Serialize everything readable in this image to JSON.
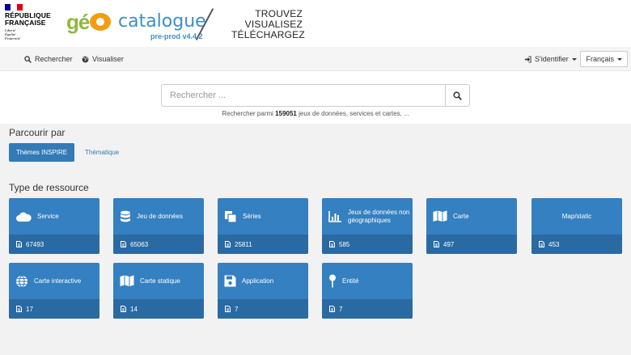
{
  "header": {
    "rf_name_line1": "RÉPUBLIQUE",
    "rf_name_line2": "FRANÇAISE",
    "rf_motto_1": "Liberté",
    "rf_motto_2": "Égalité",
    "rf_motto_3": "Fraternité",
    "logo_catalogue": "catalogue",
    "logo_version": "pre-prod v4.4.2",
    "tagline": [
      "TROUVEZ",
      "VISUALISEZ",
      "TÉLÉCHARGEZ"
    ],
    "flag_colors": [
      "#000091",
      "#ffffff",
      "#e1000f"
    ]
  },
  "nav": {
    "search": "Rechercher",
    "visualize": "Visualiser",
    "signin": "S'identifier",
    "language": "Français"
  },
  "search": {
    "placeholder": "Rechercher ...",
    "hint_prefix": "Rechercher parmi",
    "hint_count": "159051",
    "hint_suffix": "jeux de données, services et cartes, ..."
  },
  "browse": {
    "title": "Parcourir par",
    "active_tab": "Thèmes INSPIRE",
    "other_tab": "Thématique"
  },
  "resources": {
    "title": "Type de ressource",
    "tiles": [
      {
        "icon": "cloud-icon",
        "label": "Service",
        "count": "67493"
      },
      {
        "icon": "database-icon",
        "label": "Jeu de données",
        "count": "65063"
      },
      {
        "icon": "copy-icon",
        "label": "Séries",
        "count": "25811"
      },
      {
        "icon": "bar-chart-icon",
        "label": "Jeux de données non géographiques",
        "count": "585"
      },
      {
        "icon": "map-icon",
        "label": "Carte",
        "count": "497"
      },
      {
        "icon": "",
        "label": "Map/static",
        "count": "453"
      },
      {
        "icon": "globe-icon",
        "label": "Carte interactive",
        "count": "17"
      },
      {
        "icon": "map-icon",
        "label": "Carte statique",
        "count": "14"
      },
      {
        "icon": "save-icon",
        "label": "Application",
        "count": "7"
      },
      {
        "icon": "pin-icon",
        "label": "Entité",
        "count": "7"
      }
    ]
  },
  "colors": {
    "tile": "#3480c0",
    "tile_footer": "#2a6aa3",
    "accent": "#337ab7"
  }
}
